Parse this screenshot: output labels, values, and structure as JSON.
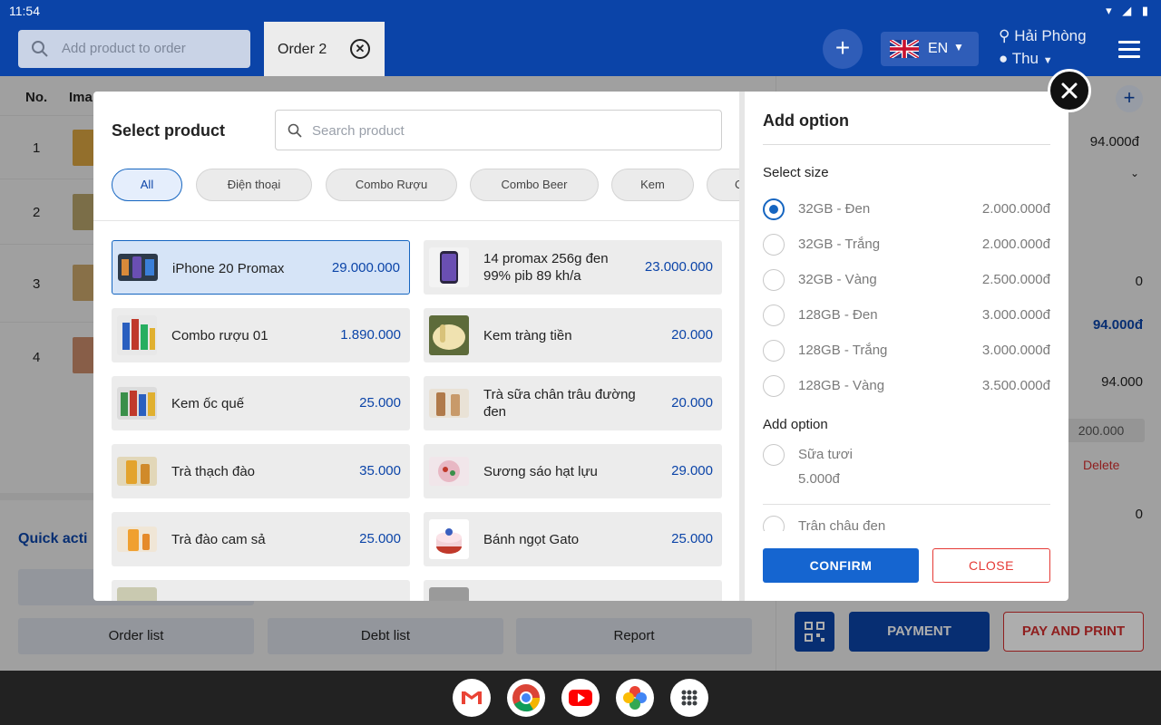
{
  "status": {
    "time": "11:54"
  },
  "header": {
    "search_placeholder": "Add product to order",
    "order_tab": "Order 2",
    "lang": "EN",
    "location": "Hải Phòng",
    "user": "Thu"
  },
  "table": {
    "col_no": "No.",
    "col_img": "Ima",
    "rows": [
      "1",
      "2",
      "3",
      "4"
    ]
  },
  "right_panel": {
    "price1": "94.000đ",
    "zero1": "0",
    "total_blue": "94.000đ",
    "price2": "94.000",
    "amount": "200.000",
    "delete": "Delete",
    "zero2": "0"
  },
  "quick": {
    "title": "Quick acti",
    "buttons": [
      "Order list",
      "Debt list",
      "Report"
    ]
  },
  "actions": {
    "payment": "PAYMENT",
    "pay_print": "PAY AND PRINT"
  },
  "modal": {
    "title": "Select product",
    "search_placeholder": "Search product",
    "categories": [
      "All",
      "Điện thoại",
      "Combo Rượu",
      "Combo Beer",
      "Kem",
      "C"
    ],
    "products": [
      {
        "name": "iPhone 20 Promax",
        "price": "29.000.000",
        "selected": true
      },
      {
        "name": "14 promax 256g đen 99% pib 89 kh/a",
        "price": "23.000.000"
      },
      {
        "name": "Combo rượu 01",
        "price": "1.890.000"
      },
      {
        "name": "Kem tràng tiền",
        "price": "20.000"
      },
      {
        "name": "Kem ốc quế",
        "price": "25.000"
      },
      {
        "name": "Trà sữa chân trâu đường đen",
        "price": "20.000"
      },
      {
        "name": "Trà thạch đào",
        "price": "35.000"
      },
      {
        "name": "Sương sáo hạt lựu",
        "price": "29.000"
      },
      {
        "name": "Trà đào cam sả",
        "price": "25.000"
      },
      {
        "name": "Bánh ngọt Gato",
        "price": "25.000"
      }
    ],
    "options": {
      "title": "Add option",
      "size_label": "Select size",
      "sizes": [
        {
          "label": "32GB - Đen",
          "price": "2.000.000đ",
          "selected": true
        },
        {
          "label": "32GB - Trắng",
          "price": "2.000.000đ"
        },
        {
          "label": "32GB - Vàng",
          "price": "2.500.000đ"
        },
        {
          "label": "128GB - Đen",
          "price": "3.000.000đ"
        },
        {
          "label": "128GB - Trắng",
          "price": "3.000.000đ"
        },
        {
          "label": "128GB - Vàng",
          "price": "3.500.000đ"
        }
      ],
      "addon_label": "Add option",
      "addons": [
        {
          "label": "Sữa tươi",
          "price": "5.000đ"
        },
        {
          "label": "Trân châu đen"
        }
      ],
      "confirm": "CONFIRM",
      "close": "CLOSE"
    }
  },
  "colors": {
    "primary": "#0b44a8",
    "accent": "#1565c0",
    "danger": "#e53935"
  },
  "taskbar_apps": [
    "gmail-icon",
    "chrome-icon",
    "youtube-icon",
    "photos-icon",
    "app-drawer-icon"
  ]
}
